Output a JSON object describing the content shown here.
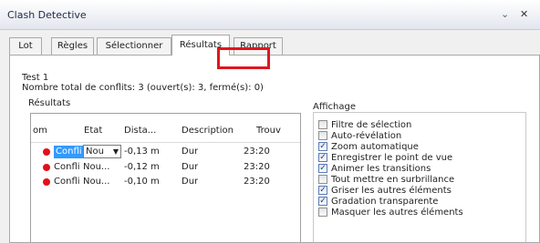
{
  "window": {
    "title": "Clash Detective",
    "pin_glyph": "⌄",
    "close_glyph": "✕"
  },
  "tabs": [
    {
      "label": "Lot",
      "active": false
    },
    {
      "label": "Règles",
      "active": false
    },
    {
      "label": "Sélectionner",
      "active": false
    },
    {
      "label": "Résultats",
      "active": true
    },
    {
      "label": "Rapport",
      "active": false
    }
  ],
  "summary": {
    "test_name": "Test 1",
    "total_line": "Nombre total de conflits: 3 (ouvert(s): 3, fermé(s): 0)"
  },
  "results": {
    "group_label": "Résultats",
    "columns": [
      "om",
      "Etat",
      "Dista...",
      "Description",
      "Trouv"
    ],
    "rows": [
      {
        "nom": "Confli",
        "etat": "Nou",
        "distance": "-0,13 m",
        "description": "Dur",
        "time": "23:20",
        "selected": true
      },
      {
        "nom": "Confli",
        "etat": "Nou...",
        "distance": "-0,12 m",
        "description": "Dur",
        "time": "23:20",
        "selected": false
      },
      {
        "nom": "Confli",
        "etat": "Nou...",
        "distance": "-0,10 m",
        "description": "Dur",
        "time": "23:20",
        "selected": false
      }
    ],
    "status_color": "#e2101a",
    "highlight_color": "#3399ff"
  },
  "affichage": {
    "group_label": "Affichage",
    "options": [
      {
        "label": "Filtre de sélection",
        "checked": false
      },
      {
        "label": "Auto-révélation",
        "checked": false
      },
      {
        "label": "Zoom automatique",
        "checked": true
      },
      {
        "label": "Enregistrer le point de vue",
        "checked": true
      },
      {
        "label": "Animer les transitions",
        "checked": true
      },
      {
        "label": "Tout mettre en surbrillance",
        "checked": false
      },
      {
        "label": "Griser les autres éléments",
        "checked": true
      },
      {
        "label": "Gradation transparente",
        "checked": true
      },
      {
        "label": "Masquer les autres éléments",
        "checked": false
      }
    ]
  },
  "accent": {
    "tab_highlight": "#e0161e"
  }
}
